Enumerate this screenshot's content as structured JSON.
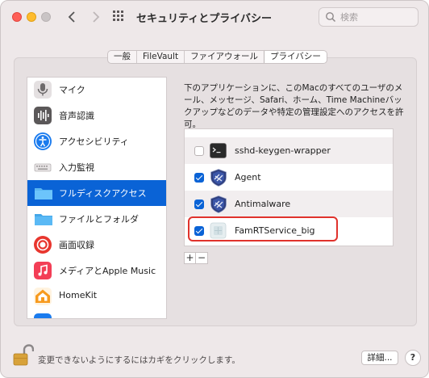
{
  "window": {
    "title": "セキュリティとプライバシー",
    "search": {
      "placeholder": "検索"
    }
  },
  "tabs": [
    {
      "label": "一般",
      "active": false
    },
    {
      "label": "FileVault",
      "active": false
    },
    {
      "label": "ファイアウォール",
      "active": false
    },
    {
      "label": "プライバシー",
      "active": true
    }
  ],
  "sidebar": {
    "items": [
      {
        "label": "マイク",
        "icon": "microphone-icon"
      },
      {
        "label": "音声認識",
        "icon": "speech-recognition-icon"
      },
      {
        "label": "アクセシビリティ",
        "icon": "accessibility-icon"
      },
      {
        "label": "入力監視",
        "icon": "keyboard-icon"
      },
      {
        "label": "フルディスクアクセス",
        "icon": "folder-icon",
        "selected": true
      },
      {
        "label": "ファイルとフォルダ",
        "icon": "folder-icon"
      },
      {
        "label": "画面収録",
        "icon": "screen-recording-icon"
      },
      {
        "label": "メディアとApple Music",
        "icon": "music-icon"
      },
      {
        "label": "HomeKit",
        "icon": "home-icon"
      }
    ]
  },
  "main": {
    "description": "下のアプリケーションに、このMacのすべてのユーザのメール、メッセージ、Safari、ホーム、Time Machineバックアップなどのデータや特定の管理設定へのアクセスを許可。",
    "apps": [
      {
        "name": "sshd-keygen-wrapper",
        "checked": false,
        "icon": "terminal-icon"
      },
      {
        "name": "Agent",
        "checked": true,
        "icon": "shield-icon"
      },
      {
        "name": "Antimalware",
        "checked": true,
        "icon": "shield-icon"
      },
      {
        "name": "FamRTService_big",
        "checked": true,
        "icon": "generic-app-icon"
      }
    ],
    "add_label": "+",
    "remove_label": "−"
  },
  "footer": {
    "lock_text": "変更できないようにするにはカギをクリックします。",
    "advanced_label": "詳細...",
    "help_label": "?"
  },
  "colors": {
    "accent": "#0a63d6",
    "highlight": "#e0322c"
  }
}
